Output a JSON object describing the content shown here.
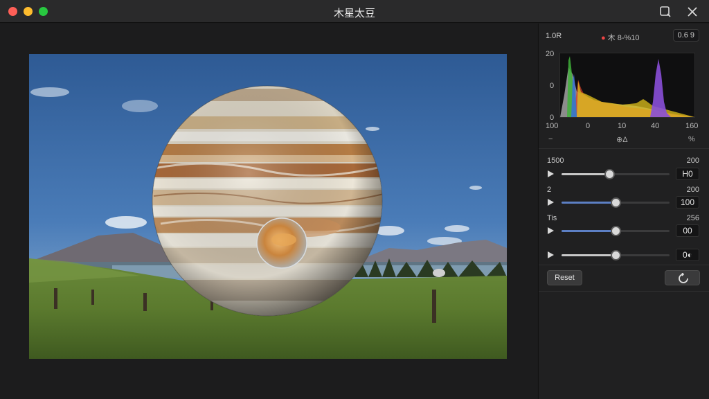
{
  "window": {
    "title": "木星太豆"
  },
  "panel": {
    "header": {
      "left": "1.0R",
      "middle": "木 8-%10",
      "right": "0.6  9"
    },
    "histogram": {
      "y_labels": [
        "20",
        "0",
        "0"
      ],
      "x_labels": [
        "100",
        "0",
        "10",
        "40",
        "160"
      ],
      "footer": {
        "left": "−",
        "middle": "⊕Δ",
        "right": "%"
      },
      "colors": {
        "gray": "#9a9a9a",
        "red": "#d23c2c",
        "yellow": "#e0c21a",
        "green": "#3fb23a",
        "blue": "#3a6fd9",
        "purple": "#8a4fd8"
      }
    },
    "sliders": [
      {
        "label": "1500",
        "value_text": "200",
        "box": "H0",
        "level": 0.44,
        "accent": "gray"
      },
      {
        "label": "2",
        "value_text": "200",
        "box": "100",
        "level": 0.5,
        "accent": "blue"
      },
      {
        "label": "Tis",
        "value_text": "256",
        "box": "00",
        "level": 0.5,
        "accent": "blue"
      },
      {
        "label": "",
        "value_text": "",
        "box": "0◐",
        "level": 0.5,
        "accent": "gray"
      }
    ],
    "buttons": {
      "reset": "Reset"
    }
  },
  "photo": {
    "subject": "Jupiter over mountain meadow"
  }
}
